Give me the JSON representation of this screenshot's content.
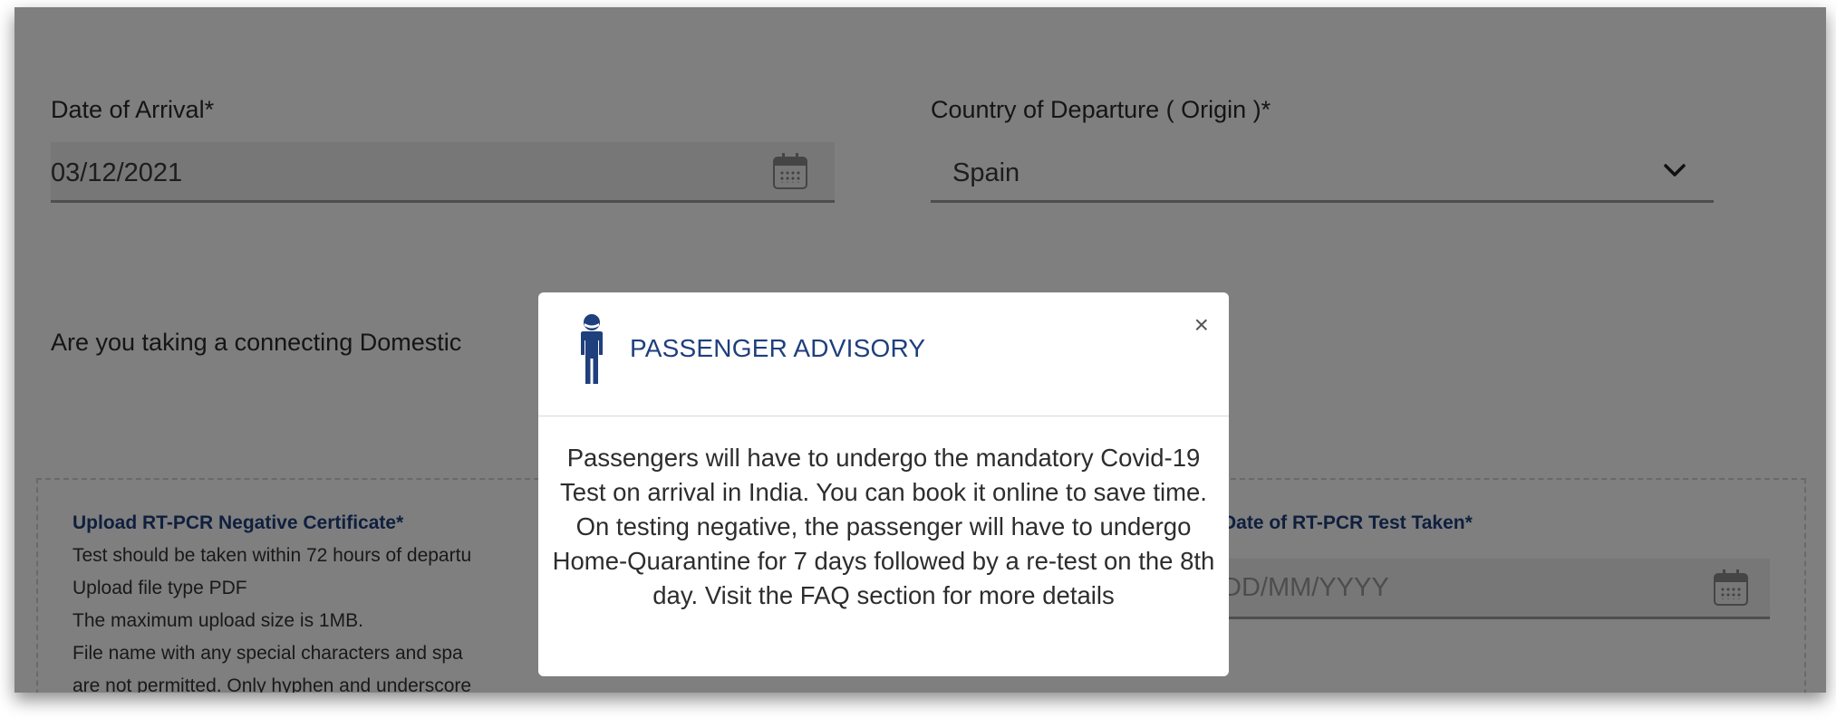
{
  "form": {
    "arrival_label": "Date of Arrival*",
    "arrival_value": "03/12/2021",
    "departure_label": "Country of Departure ( Origin )*",
    "departure_value": "Spain",
    "connecting_question": "Are you taking a connecting Domestic",
    "upload": {
      "title": "Upload RT-PCR Negative Certificate*",
      "lines": [
        "Test should be taken within 72 hours of departu",
        "Upload file type PDF",
        "The maximum upload size is 1MB.",
        "File name with any special characters and spa",
        "are not permitted. Only hyphen and underscore"
      ]
    },
    "test_date_label": "Date of RT-PCR Test Taken*",
    "test_date_placeholder": "DD/MM/YYYY"
  },
  "modal": {
    "title": "PASSENGER ADVISORY",
    "close": "×",
    "message": "Passengers will have to undergo the mandatory Covid-19 Test on arrival in India. You can book it online to save time. On testing negative, the passenger will have to undergo Home-Quarantine for 7 days followed by a re-test on the 8th day. Visit the FAQ section for more details"
  },
  "colors": {
    "accent": "#1f3f7d",
    "overlay": "rgba(0,0,0,0.5)"
  },
  "icons": [
    "calendar-icon",
    "chevron-down-icon",
    "passenger-mask-icon",
    "close-icon"
  ]
}
